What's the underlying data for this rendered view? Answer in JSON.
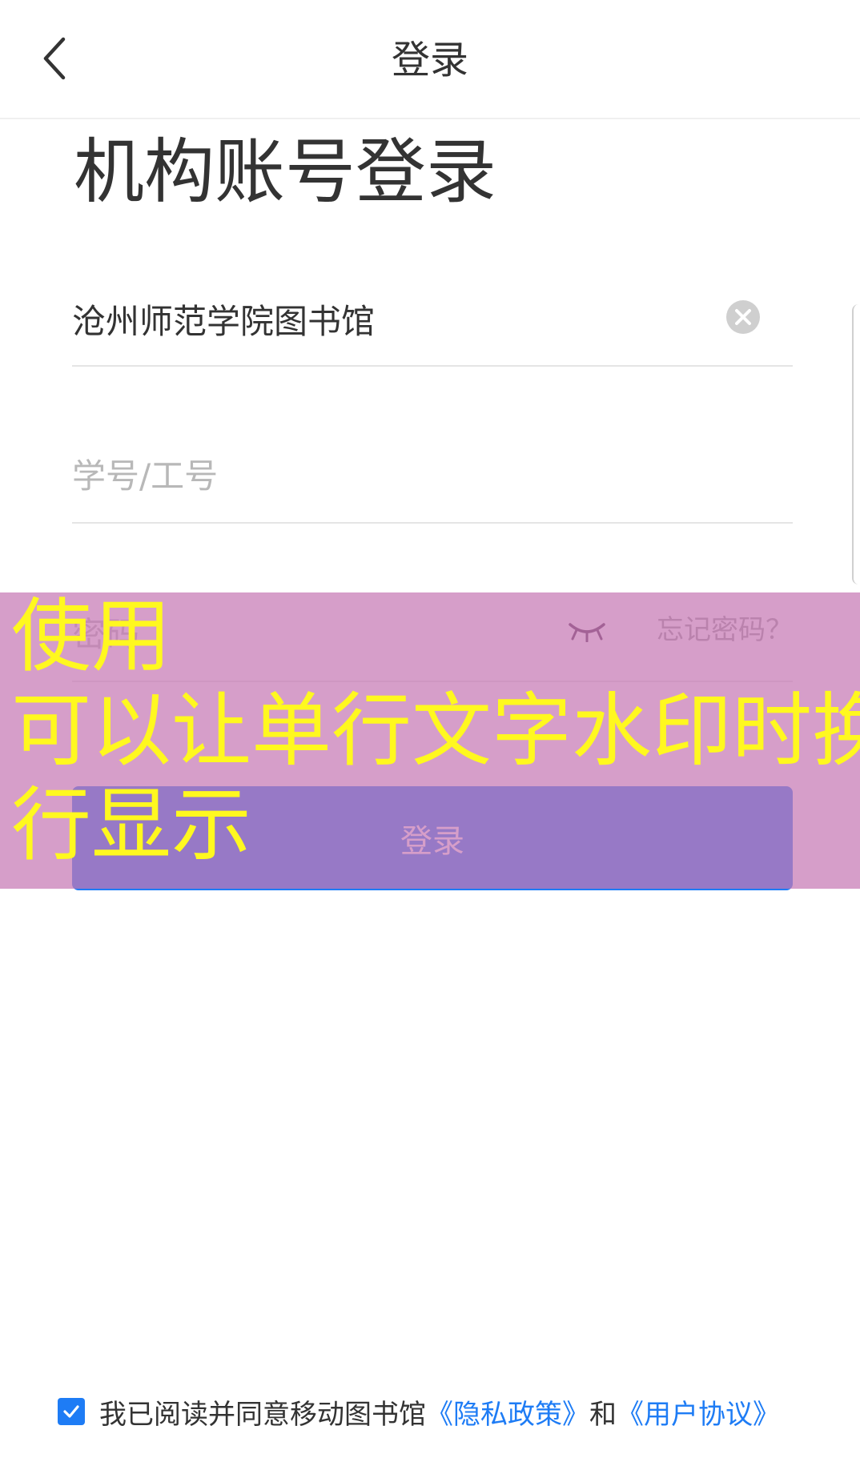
{
  "header": {
    "title": "登录"
  },
  "main": {
    "title": "机构账号登录",
    "institution_value": "沧州师范学院图书馆",
    "account_placeholder": "学号/工号",
    "password_placeholder": "密码",
    "forgot_label": "忘记密码？",
    "login_label": "登录"
  },
  "agreement": {
    "prefix": "我已阅读并同意移动图书馆",
    "privacy_label": "《隐私政策》",
    "conjunction": "和",
    "terms_label": "《用户协议》",
    "checked": true
  },
  "watermark": {
    "lines": [
      "使用",
      "可以让单行文字水印时换",
      "行显示"
    ]
  },
  "colors": {
    "accent": "#1e7cf5",
    "watermark_bg": "#c678b4",
    "watermark_text": "#fff81f"
  },
  "icons": {
    "back": "chevron-left-icon",
    "clear": "clear-circle-icon",
    "password_visibility": "eye-closed-icon",
    "checkbox": "checkmark-icon"
  }
}
